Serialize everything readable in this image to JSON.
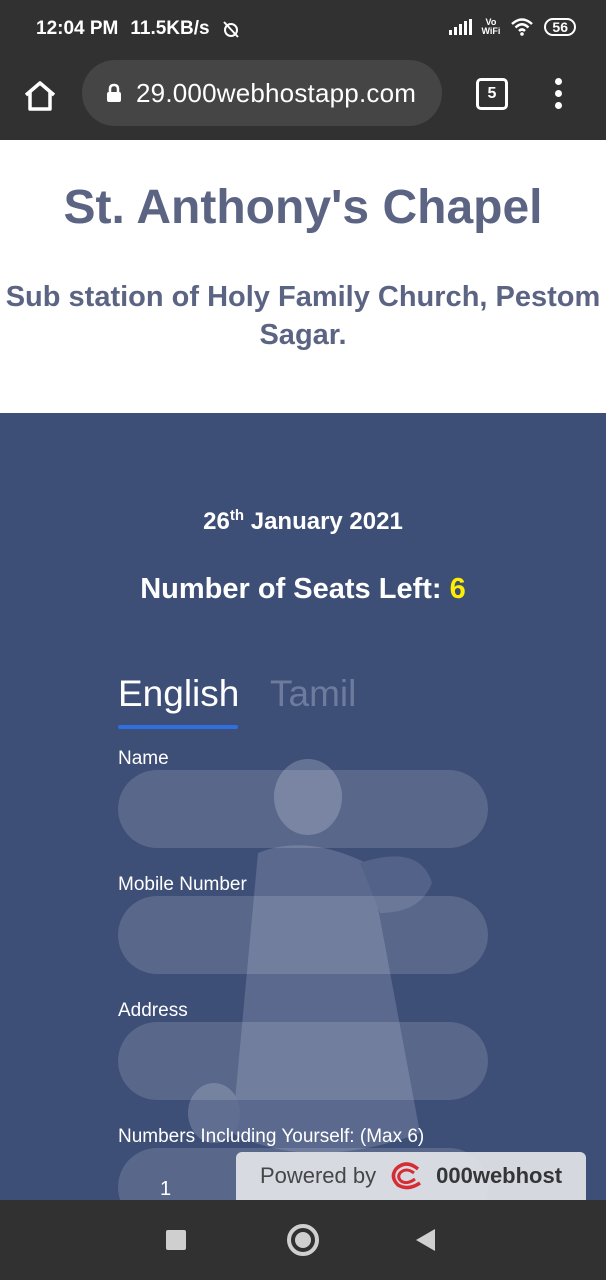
{
  "status_bar": {
    "time": "12:04 PM",
    "speed": "11.5KB/s",
    "vowifi_top": "Vo",
    "vowifi_bottom": "WiFi",
    "battery": "56",
    "icons": [
      "alarm-off-icon",
      "signal-icon",
      "vowifi-icon",
      "wifi-icon",
      "battery-icon"
    ]
  },
  "browser": {
    "url": "29.000webhostapp.com",
    "tab_count": "5",
    "icons": [
      "home-icon",
      "lock-icon",
      "tabs-icon",
      "more-vert-icon"
    ]
  },
  "header": {
    "title": "St. Anthony's Chapel",
    "subtitle_line1": "Sub station of Holy Family Church, Pestom",
    "subtitle_line2": "Sagar."
  },
  "event": {
    "date_day": "26",
    "date_suffix": "th",
    "date_rest": " January 2021",
    "seats_label": "Number of Seats Left: ",
    "seats_value": "6"
  },
  "tabs": [
    {
      "label": "English",
      "active": true
    },
    {
      "label": "Tamil",
      "active": false
    }
  ],
  "form": {
    "name_label": "Name",
    "name_value": "",
    "mobile_label": "Mobile Number",
    "mobile_value": "",
    "address_label": "Address",
    "address_value": "",
    "count_label": "Numbers Including Yourself: (Max 6)",
    "count_value": "1"
  },
  "badge": {
    "prefix": "Powered by",
    "brand": "000webhost"
  },
  "colors": {
    "panel_bg": "#3d4e77",
    "header_text": "#5c6484",
    "seats_highlight": "#ffee00",
    "tab_underline": "#2f6fe0",
    "system_bar": "#313131"
  }
}
